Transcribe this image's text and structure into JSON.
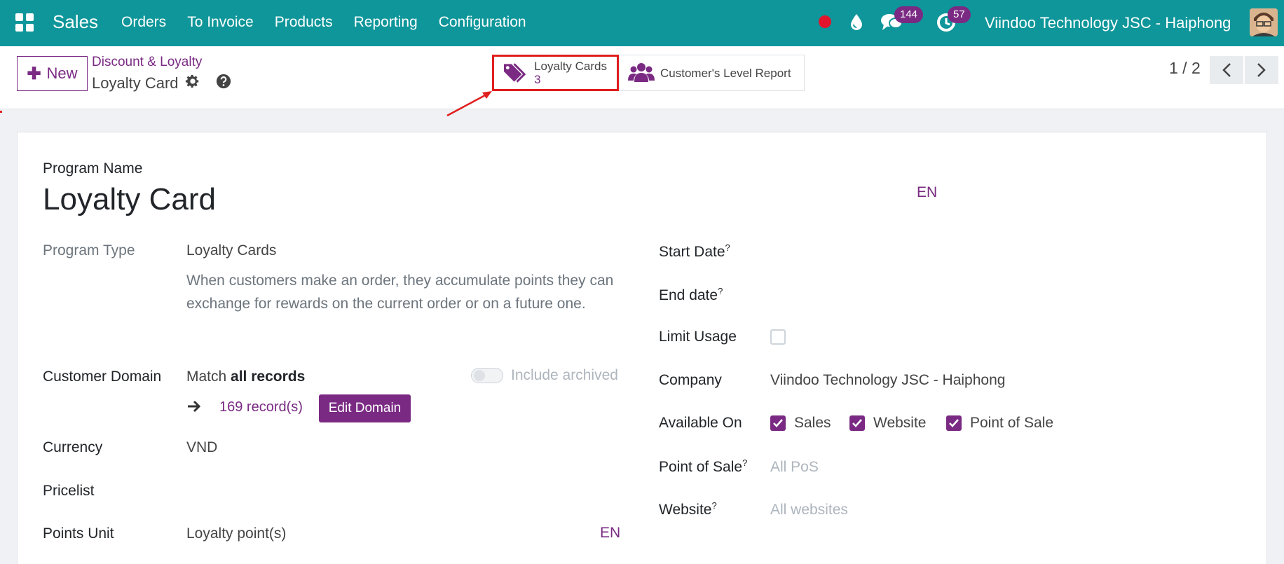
{
  "navbar": {
    "app_name": "Sales",
    "menu": [
      "Orders",
      "To Invoice",
      "Products",
      "Reporting",
      "Configuration"
    ],
    "message_count": "144",
    "activity_count": "57",
    "company": "Viindoo Technology JSC - Haiphong",
    "icons": [
      "apps-icon",
      "record-icon",
      "drop-icon",
      "chat-icon",
      "clock-icon",
      "avatar"
    ]
  },
  "control_panel": {
    "new_label": "New",
    "breadcrumb": "Discount & Loyalty",
    "record_title": "Loyalty Card",
    "smart_buttons": {
      "loyalty_cards_label": "Loyalty Cards",
      "loyalty_cards_value": "3",
      "level_report_label": "Customer's Level Report"
    },
    "pager": "1 / 2"
  },
  "form": {
    "program_name_label": "Program Name",
    "program_name": "Loyalty Card",
    "lang": "EN",
    "left": {
      "program_type_label": "Program Type",
      "program_type_value": "Loyalty Cards",
      "program_type_desc": "When customers make an order, they accumulate points they can exchange for rewards on the current order or on a future one.",
      "customer_domain_label": "Customer Domain",
      "domain_match_prefix": "Match",
      "domain_match_bold": "all records",
      "include_archived": "Include archived",
      "record_count": "169 record(s)",
      "edit_domain": "Edit Domain",
      "currency_label": "Currency",
      "currency_value": "VND",
      "pricelist_label": "Pricelist",
      "points_unit_label": "Points Unit",
      "points_unit_value": "Loyalty point(s)"
    },
    "right": {
      "start_date_label": "Start Date",
      "end_date_label": "End date",
      "limit_usage_label": "Limit Usage",
      "company_label": "Company",
      "company_value": "Viindoo Technology JSC - Haiphong",
      "available_on_label": "Available On",
      "available_on": [
        "Sales",
        "Website",
        "Point of Sale"
      ],
      "pos_label": "Point of Sale",
      "pos_placeholder": "All PoS",
      "website_label": "Website",
      "website_placeholder": "All websites",
      "help_mark": "?"
    }
  },
  "colors": {
    "navbar": "#0f969a",
    "primary": "#7a2a83",
    "highlight": "#e01e1e"
  }
}
